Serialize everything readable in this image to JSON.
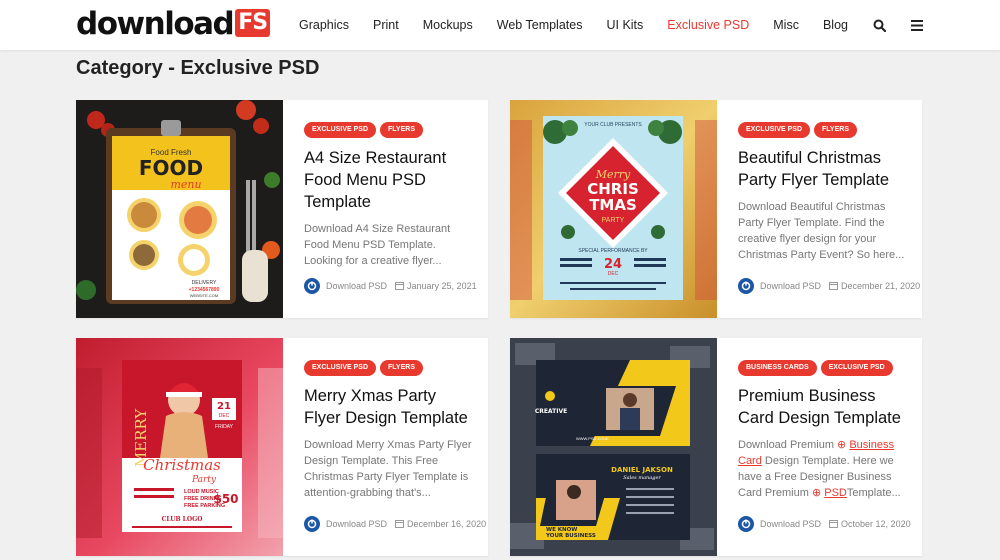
{
  "header": {
    "logo_text": "download",
    "logo_badge": "FS",
    "nav": [
      {
        "label": "Graphics",
        "active": false
      },
      {
        "label": "Print",
        "active": false
      },
      {
        "label": "Mockups",
        "active": false
      },
      {
        "label": "Web Templates",
        "active": false
      },
      {
        "label": "UI Kits",
        "active": false
      },
      {
        "label": "Exclusive PSD",
        "active": true
      },
      {
        "label": "Misc",
        "active": false
      },
      {
        "label": "Blog",
        "active": false
      }
    ],
    "icons": [
      "search-icon",
      "menu-icon"
    ]
  },
  "page_title": "Category - Exclusive PSD",
  "colors": {
    "accent": "#e8392f",
    "author_badge": "#1b57a6",
    "background": "#f0f0f0"
  },
  "posts": [
    {
      "tags": [
        "EXCLUSIVE PSD",
        "FLYERS"
      ],
      "title": "A4 Size Restaurant Food Menu PSD Template",
      "excerpt": "Download A4 Size Restaurant Food Menu PSD Template. Looking for a creative flyer...",
      "author": "Download PSD",
      "date": "January 25, 2021",
      "thumb": {
        "line1": "FOOD",
        "line2": "menu",
        "line3": "Food Fresh",
        "line4": "DELIVERY",
        "line5": "+1234567890",
        "line6": "WEBSITE.COM"
      }
    },
    {
      "tags": [
        "EXCLUSIVE PSD",
        "FLYERS"
      ],
      "title": "Beautiful Christmas Party Flyer Template",
      "excerpt": "Download Beautiful Christmas Party Flyer Template. Find the creative flyer design for your Christmas Party Event? So here...",
      "author": "Download PSD",
      "date": "December 21, 2020",
      "thumb": {
        "line1": "YOUR CLUB PRESENTS",
        "line2": "Merry",
        "line3": "CHRIS",
        "line4": "TMAS",
        "line5": "PARTY",
        "line6": "SPECIAL PERFORMANCE BY",
        "line7": "24",
        "line8": "DEC"
      }
    },
    {
      "tags": [
        "EXCLUSIVE PSD",
        "FLYERS"
      ],
      "title": "Merry Xmas Party Flyer Design Template",
      "excerpt": "Download Merry Xmas Party Flyer Design Template. This Free Christmas Party Flyer Template is attention-grabbing that's...",
      "author": "Download PSD",
      "date": "December 16, 2020",
      "thumb": {
        "line1": "MERRY",
        "line2": "Christmas",
        "line3": "Party",
        "line4": "21",
        "line5": "DEC",
        "line6": "FRIDAY",
        "line7": "LOUD MUSIC",
        "line8": "FREE DRINKS",
        "line9": "FREE PARKING",
        "line10": "$50",
        "line11": "CLUB LOGO"
      }
    },
    {
      "tags": [
        "BUSINESS CARDS",
        "EXCLUSIVE PSD"
      ],
      "title": "Premium Business Card Design Template",
      "excerpt_parts": [
        "Download Premium ",
        "Business Card",
        " Design Template. Here we have a Free Designer Business Card Premium ",
        "PSD",
        "Template..."
      ],
      "author": "Download PSD",
      "date": "October 12, 2020",
      "thumb": {
        "line1": "CREATIVE",
        "line2": "WWW.PSD.ZONE",
        "line3": "DANIEL JAKSON",
        "line4": "Sales manager",
        "line5": "WE KNOW",
        "line6": "YOUR BUSINESS"
      }
    }
  ]
}
